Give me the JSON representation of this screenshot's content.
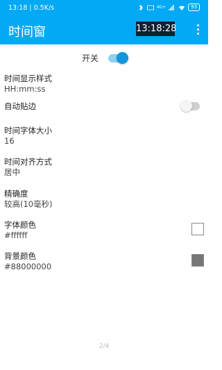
{
  "status_bar": {
    "time_speed": "13:18 | 0.5K/s",
    "battery": "93",
    "network": "4G+"
  },
  "app_bar": {
    "title": "时间窗",
    "clock_preview": "13:18:28"
  },
  "master_switch": {
    "label": "开关",
    "state": "on"
  },
  "settings": [
    {
      "title": "时间显示样式",
      "value": "HH:mm:ss"
    },
    {
      "title": "自动贴边",
      "switch": "off"
    },
    {
      "title": "时间字体大小",
      "value": "16"
    },
    {
      "title": "时间对齐方式",
      "value": "居中"
    },
    {
      "title": "精确度",
      "value": "较高(10毫秒)"
    },
    {
      "title": "字体颜色",
      "value": "#ffffff",
      "swatch_color": "#ffffff"
    },
    {
      "title": "背景颜色",
      "value": "#88000000",
      "swatch_color": "#777777"
    }
  ],
  "page_indicator": "2/4",
  "colors": {
    "primary": "#03a9f4",
    "accent": "#1296db"
  }
}
